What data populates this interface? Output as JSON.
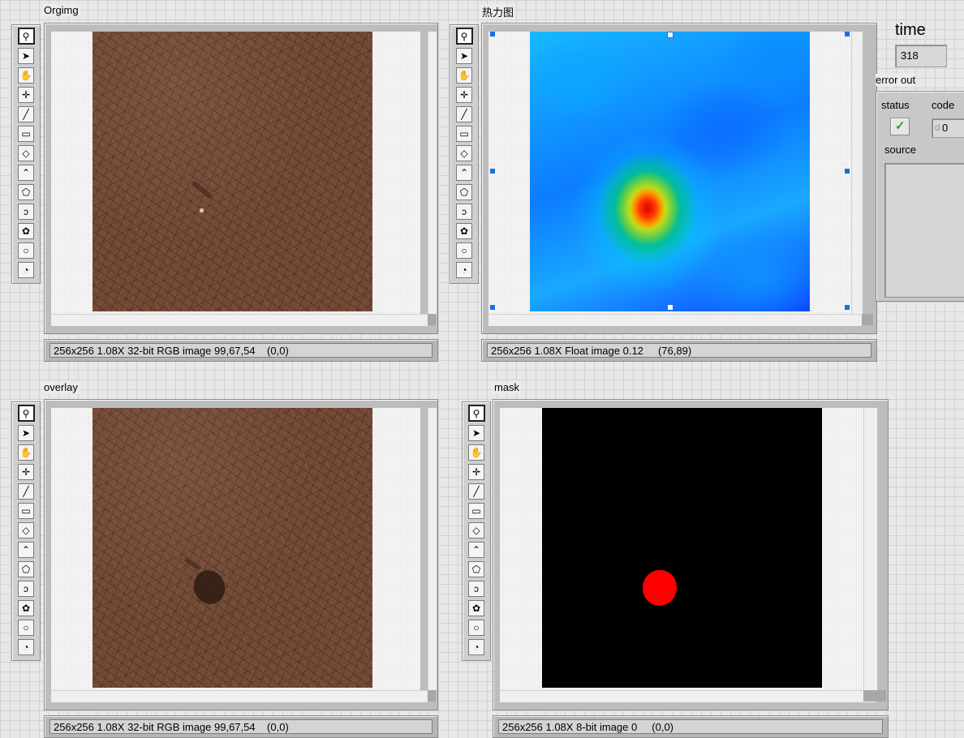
{
  "displays": {
    "orgimg": {
      "label": "Orgimg",
      "status": "256x256 1.08X 32-bit RGB image 99,67,54    (0,0)"
    },
    "heatmap": {
      "label": "热力图",
      "status": "256x256 1.08X Float image 0.12     (76,89)"
    },
    "overlay": {
      "label": "overlay",
      "status": "256x256 1.08X 32-bit RGB image 99,67,54    (0,0)"
    },
    "mask": {
      "label": "mask",
      "status": "256x256 1.08X 8-bit image 0     (0,0)"
    }
  },
  "tools": [
    {
      "icon": "zoom-icon",
      "glyph": "⚲"
    },
    {
      "icon": "pointer-icon",
      "glyph": "➤"
    },
    {
      "icon": "pan-hand-icon",
      "glyph": "✋"
    },
    {
      "icon": "crosshair-icon",
      "glyph": "✛"
    },
    {
      "icon": "line-icon",
      "glyph": "╱"
    },
    {
      "icon": "rectangle-icon",
      "glyph": "▭"
    },
    {
      "icon": "rotated-rect-icon",
      "glyph": "◇"
    },
    {
      "icon": "polyline-icon",
      "glyph": "⌃"
    },
    {
      "icon": "polygon-icon",
      "glyph": "⬠"
    },
    {
      "icon": "freehand-line-icon",
      "glyph": "ↄ"
    },
    {
      "icon": "freehand-region-icon",
      "glyph": "✿"
    },
    {
      "icon": "oval-icon",
      "glyph": "○"
    },
    {
      "icon": "annulus-icon",
      "glyph": "◔"
    }
  ],
  "side": {
    "time_label": "time",
    "time_value": "318",
    "error_label": "error out",
    "status_label": "status",
    "code_label": "code",
    "code_value": "0",
    "code_prefix": "d",
    "source_label": "source",
    "status_check": "✓"
  },
  "colors": {
    "mask_blob": "#ff0000",
    "status_ok": "#2aa52a"
  }
}
